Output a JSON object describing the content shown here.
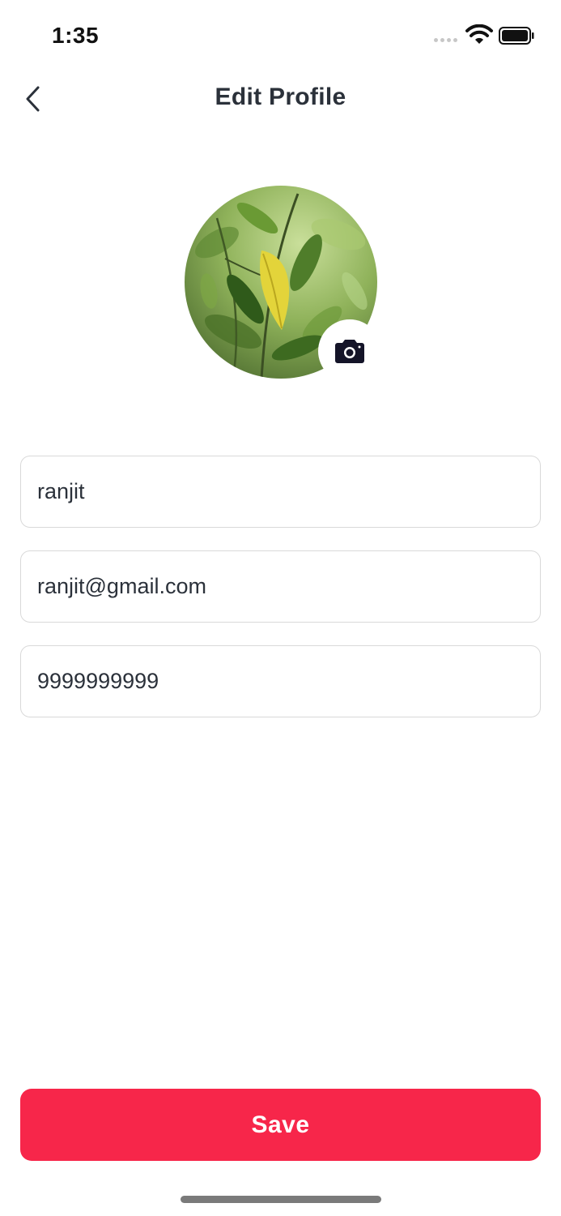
{
  "status_bar": {
    "time": "1:35"
  },
  "header": {
    "title": "Edit Profile"
  },
  "profile": {
    "avatar_icon": "leaf-photo",
    "camera_icon": "camera-icon"
  },
  "form": {
    "name_value": "ranjit",
    "email_value": "ranjit@gmail.com",
    "phone_value": "9999999999"
  },
  "actions": {
    "save_label": "Save"
  },
  "colors": {
    "primary": "#f7264a",
    "text": "#2b313a",
    "border": "#d9d9d9",
    "camera_icon": "#141428"
  }
}
